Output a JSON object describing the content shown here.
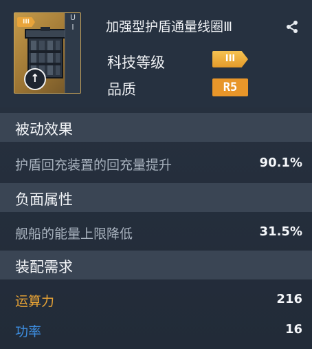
{
  "item": {
    "rank_tag": "III",
    "strip_top": "U",
    "strip_bottom": "I",
    "title": "加强型护盾通量线圈Ⅲ"
  },
  "info": {
    "tech_label": "科技等级",
    "tech_badge": "III",
    "quality_label": "品质",
    "quality_badge": "R5"
  },
  "sections": {
    "passive": {
      "title": "被动效果",
      "label": "护盾回充装置的回充量提升",
      "value": "90.1%"
    },
    "negative": {
      "title": "负面属性",
      "label": "舰船的能量上限降低",
      "value": "31.5%"
    },
    "requirements": {
      "title": "装配需求",
      "compute_label": "运算力",
      "compute_value": "216",
      "power_label": "功率",
      "power_value": "16"
    }
  },
  "colors": {
    "accent_orange": "#e9a435",
    "accent_blue": "#3d8ee0",
    "quality": "#e8962a"
  }
}
